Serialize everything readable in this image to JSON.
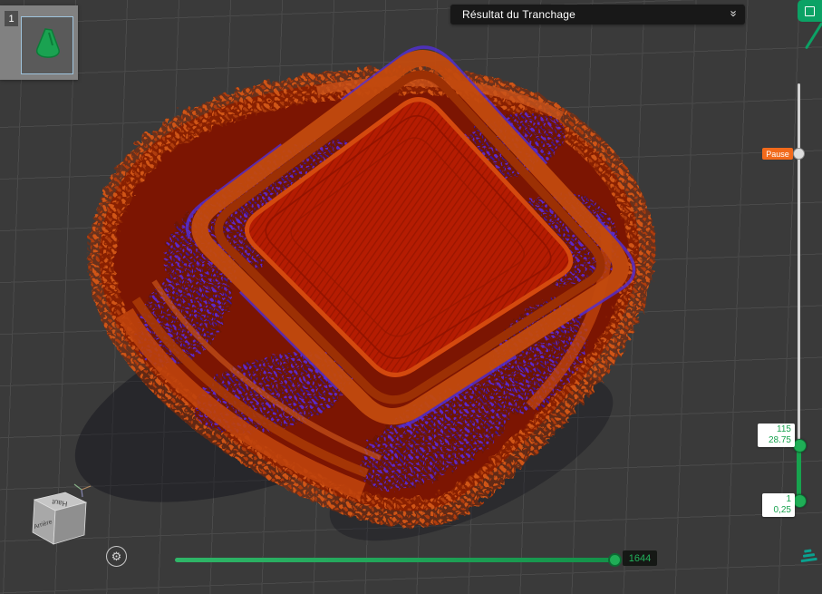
{
  "header": {
    "view_mode_dropdown": {
      "label": "Résultat du Tranchage"
    }
  },
  "object_list": {
    "extruder_number": "1"
  },
  "layer_slider": {
    "pause_label": "Pause",
    "upper_handle": {
      "layer": "115",
      "height": "28.75"
    },
    "lower_handle": {
      "layer": "1",
      "height": "0,25"
    }
  },
  "playback_slider": {
    "value": "1644"
  },
  "view_cube": {
    "top_label": "Haut",
    "back_label": "Arrière"
  },
  "icons": {
    "dropdown_chevron": "»",
    "gear": "⚙"
  },
  "colors": {
    "accent_green": "#17a24e",
    "pause_orange": "#f26a1b",
    "model_wall_orange": "#c2440c",
    "model_skin_red": "#b51c02",
    "infill_purple": "#5b2bd6",
    "canvas_background": "#3a3a3a",
    "grid_line": "#4a4a4a"
  }
}
